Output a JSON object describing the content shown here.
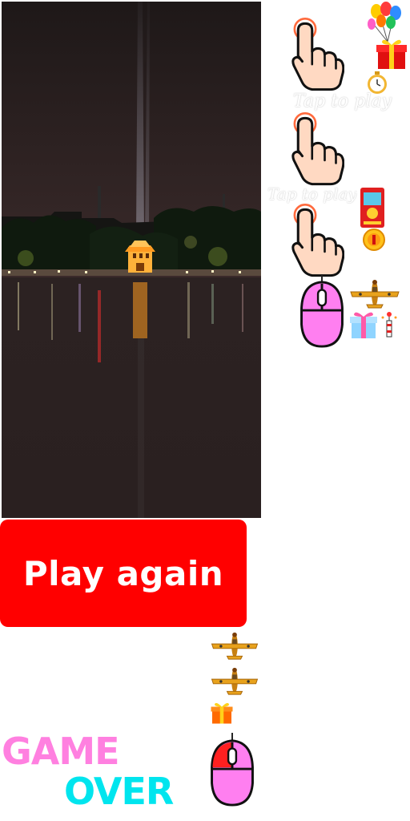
{
  "sprites": {
    "hint_tap_label_1": "Tap to play",
    "hint_tap_label_2": "Tap to play"
  },
  "buttons": {
    "play_again_label": "Play again"
  },
  "game_over": {
    "line1": "GAME",
    "line2": "OVER",
    "line1_color": "#ff80e0",
    "line2_color": "#00e5ee"
  },
  "icons": [
    "finger-tap-icon",
    "balloons-icon",
    "gift-box-icon",
    "stopwatch-icon",
    "red-envelope-icon",
    "gold-coin-icon",
    "mouse-click-icon",
    "airplane-icon",
    "firecracker-gift-icon",
    "small-gift-icon"
  ],
  "colors": {
    "play_again_bg": "#ff0000",
    "mouse_body": "#ff7ff0",
    "tap_ring": "#ff6a3d",
    "plane_body": "#e8a21c"
  }
}
